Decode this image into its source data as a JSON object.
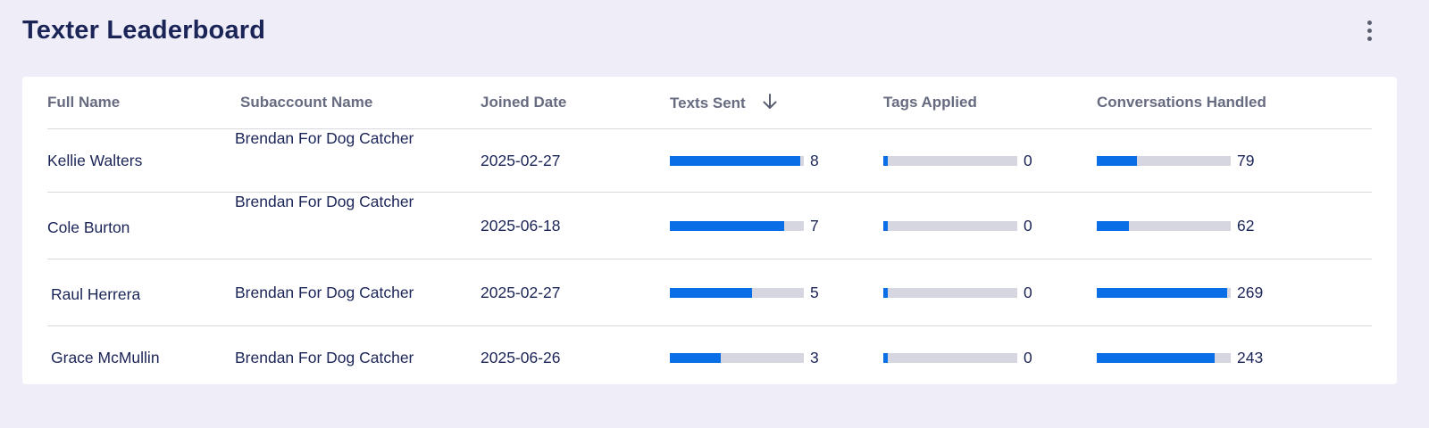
{
  "header": {
    "title": "Texter Leaderboard",
    "menu_icon": "more-vertical-icon"
  },
  "table": {
    "columns": [
      {
        "label": "Full Name"
      },
      {
        "label": "Subaccount Name"
      },
      {
        "label": "Joined Date"
      },
      {
        "label": "Texts Sent",
        "sort_icon": "arrow-down-icon",
        "sorted": "descending"
      },
      {
        "label": "Tags Applied"
      },
      {
        "label": "Conversations Handled"
      }
    ],
    "bar_color": "#0a6ee6",
    "track_color": "#d5d6df",
    "rows": [
      {
        "full_name": "Kellie Walters",
        "subaccount": "Brendan For Dog Catcher",
        "joined": "2025-02-27",
        "texts_sent": "8",
        "texts_sent_fraction": 0.97,
        "tags_applied": "0",
        "tags_applied_fraction": 0.03,
        "conversations": "79",
        "conversations_fraction": 0.3
      },
      {
        "full_name": "Cole Burton",
        "subaccount": "Brendan For Dog Catcher",
        "joined": "2025-06-18",
        "texts_sent": "7",
        "texts_sent_fraction": 0.85,
        "tags_applied": "0",
        "tags_applied_fraction": 0.03,
        "conversations": "62",
        "conversations_fraction": 0.24
      },
      {
        "full_name": "Raul Herrera",
        "subaccount": "Brendan For Dog Catcher",
        "joined": "2025-02-27",
        "texts_sent": "5",
        "texts_sent_fraction": 0.61,
        "tags_applied": "0",
        "tags_applied_fraction": 0.03,
        "conversations": "269",
        "conversations_fraction": 0.97
      },
      {
        "full_name": "Grace McMullin",
        "subaccount": "Brendan For Dog Catcher",
        "joined": "2025-06-26",
        "texts_sent": "3",
        "texts_sent_fraction": 0.38,
        "tags_applied": "0",
        "tags_applied_fraction": 0.03,
        "conversations": "243",
        "conversations_fraction": 0.88
      }
    ]
  }
}
